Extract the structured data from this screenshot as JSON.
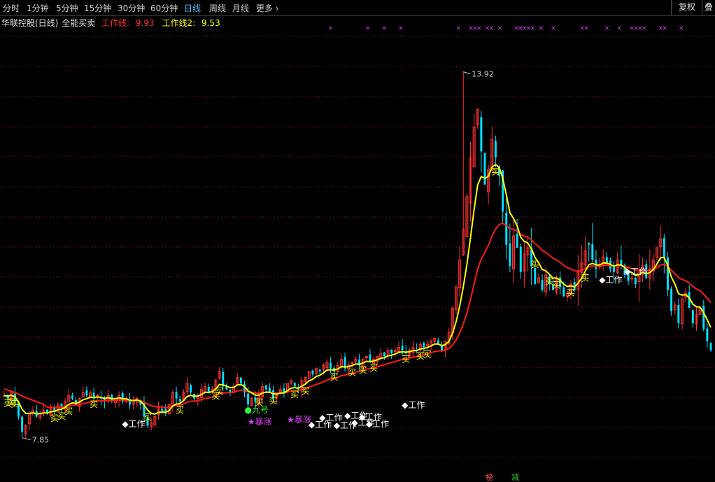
{
  "toolbar": {
    "periods": [
      "分时",
      "1分钟",
      "5分钟",
      "15分钟",
      "30分钟",
      "60分钟",
      "日线",
      "周线",
      "月线"
    ],
    "active_period": "日线",
    "more_label": "更多",
    "fuquan_label": "复权",
    "die_label": "叠"
  },
  "legend": {
    "stock": "华联控股(日线)",
    "indicator": "全能买卖",
    "line1_label": "工作线:",
    "line1_value": "9.93",
    "line2_label": "工作线2:",
    "line2_value": "9.53"
  },
  "colors": {
    "up": "#ff3232",
    "down": "#00e0ff",
    "line1": "#ff1a1a",
    "line2": "#ffff00",
    "grid": "#8b1a1a",
    "signal_buy": "#ffff00",
    "signal_work": "#ffffff",
    "signal_star": "#e040fb",
    "signal_nine": "#33ff33",
    "marker_x": "#e040fb"
  },
  "chart_data": {
    "type": "candlestick",
    "price_range": [
      7.5,
      14.6
    ],
    "max_label": "13.92",
    "min_label": "7.85",
    "closes": [
      8.55,
      8.5,
      8.6,
      8.45,
      8.2,
      7.95,
      8.05,
      8.25,
      8.3,
      8.2,
      8.25,
      8.3,
      8.25,
      8.35,
      8.3,
      8.4,
      8.35,
      8.45,
      8.55,
      8.5,
      8.4,
      8.5,
      8.6,
      8.55,
      8.6,
      8.5,
      8.55,
      8.5,
      8.45,
      8.55,
      8.45,
      8.5,
      8.55,
      8.45,
      8.5,
      8.4,
      8.45,
      8.5,
      8.4,
      8.2,
      8.05,
      8.1,
      8.2,
      8.35,
      8.3,
      8.25,
      8.4,
      8.6,
      8.5,
      8.45,
      8.6,
      8.75,
      8.6,
      8.5,
      8.55,
      8.65,
      8.7,
      8.6,
      8.65,
      8.8,
      8.95,
      8.7,
      8.65,
      8.6,
      8.7,
      8.85,
      8.75,
      8.6,
      8.4,
      8.5,
      8.45,
      8.55,
      8.7,
      8.65,
      8.6,
      8.5,
      8.55,
      8.65,
      8.6,
      8.75,
      8.8,
      8.7,
      8.65,
      8.8,
      8.85,
      8.95,
      8.9,
      9.0,
      8.95,
      9.05,
      9.1,
      9.0,
      8.95,
      9.05,
      9.15,
      9.0,
      9.05,
      9.1,
      9.15,
      9.05,
      9.15,
      9.2,
      9.1,
      9.15,
      9.2,
      9.25,
      9.2,
      9.3,
      9.25,
      9.3,
      9.35,
      9.3,
      9.25,
      9.3,
      9.35,
      9.3,
      9.4,
      9.35,
      9.4,
      9.45,
      9.5,
      9.4,
      9.3,
      9.45,
      9.6,
      10.0,
      10.35,
      10.8,
      11.3,
      11.85,
      12.5,
      13.0,
      13.3,
      12.6,
      12.05,
      12.3,
      12.8,
      12.5,
      12.2,
      11.6,
      11.05,
      10.7,
      11.2,
      11.0,
      10.6,
      10.9,
      11.0,
      10.7,
      10.4,
      10.5,
      10.3,
      10.55,
      10.4,
      10.3,
      10.5,
      10.35,
      10.2,
      10.25,
      10.4,
      10.3,
      10.6,
      10.75,
      10.95,
      11.05,
      10.8,
      10.65,
      10.7,
      10.85,
      10.75,
      10.65,
      10.6,
      10.8,
      10.7,
      10.55,
      10.45,
      10.5,
      10.4,
      10.6,
      10.7,
      10.5,
      10.65,
      10.8,
      11.0,
      11.15,
      10.85,
      10.3,
      9.95,
      10.05,
      9.75,
      10.15,
      10.25,
      10.0,
      9.75,
      9.9,
      10.0,
      9.65,
      9.45,
      9.3
    ]
  }
}
